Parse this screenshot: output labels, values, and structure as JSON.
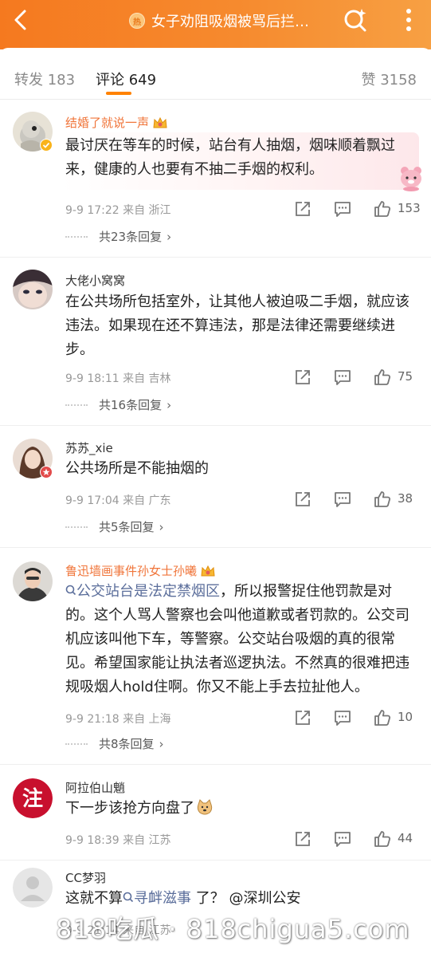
{
  "header": {
    "title": "女子劝阻吸烟被骂后拦…",
    "badge_text": "热",
    "colors": {
      "gradient_start": "#f5791f",
      "gradient_end": "#f7a043"
    },
    "icons": {
      "back": "back-arrow-icon",
      "search": "super-search-icon",
      "more": "more-dots-icon"
    }
  },
  "tabs": {
    "repost": "转发 183",
    "comment": "评论 649",
    "like": "赞 3158",
    "accent": "#ff8200"
  },
  "comments": [
    {
      "name": "结婚了就说一声",
      "vip": true,
      "content": "最讨厌在等车的时候，站台有人抽烟，烟味顺着飘过来，健康的人也要有不抽二手烟的权利。",
      "meta": "9-9 17:22  来自 浙江",
      "likes": "153",
      "replies": "共23条回复"
    },
    {
      "name": "大佬小窝窝",
      "vip": false,
      "content": "在公共场所包括室外，让其他人被迫吸二手烟，就应该违法。如果现在还不算违法，那是法律还需要继续进步。",
      "meta": "9-9 18:11  来自 吉林",
      "likes": "75",
      "replies": "共16条回复"
    },
    {
      "name": "苏苏_xie",
      "vip": false,
      "content": "公共场所是不能抽烟的",
      "meta": "9-9 17:04  来自 广东",
      "likes": "38",
      "replies": "共5条回复"
    },
    {
      "name": "鲁迅墙画事件孙女士孙曦",
      "vip": true,
      "topic": "公交站台是法定禁烟区",
      "content": "，所以报警捉住他罚款是对的。这个人骂人警察也会叫他道歉或者罚款的。公交司机应该叫他下车，等警察。公交站台吸烟的真的很常见。希望国家能让执法者巡逻执法。不然真的很难把违规吸烟人hold住啊。你又不能上手去拉扯他人。",
      "meta": "9-9 21:18  来自 上海",
      "likes": "10",
      "replies": "共8条回复"
    },
    {
      "name": "阿拉伯山魈",
      "vip": false,
      "avatar_text": "注",
      "content": "下一步该抢方向盘了",
      "meta": "9-9 18:39  来自 江苏",
      "likes": "44"
    },
    {
      "name": "CC梦羽",
      "vip": false,
      "content_prefix": "这就不算",
      "topic": "寻衅滋事",
      "content_suffix": " 了？ @深圳公安",
      "meta": "9-9 21:14  来自 江苏"
    }
  ],
  "watermark": "818吃瓜 · 818chigua5.com"
}
